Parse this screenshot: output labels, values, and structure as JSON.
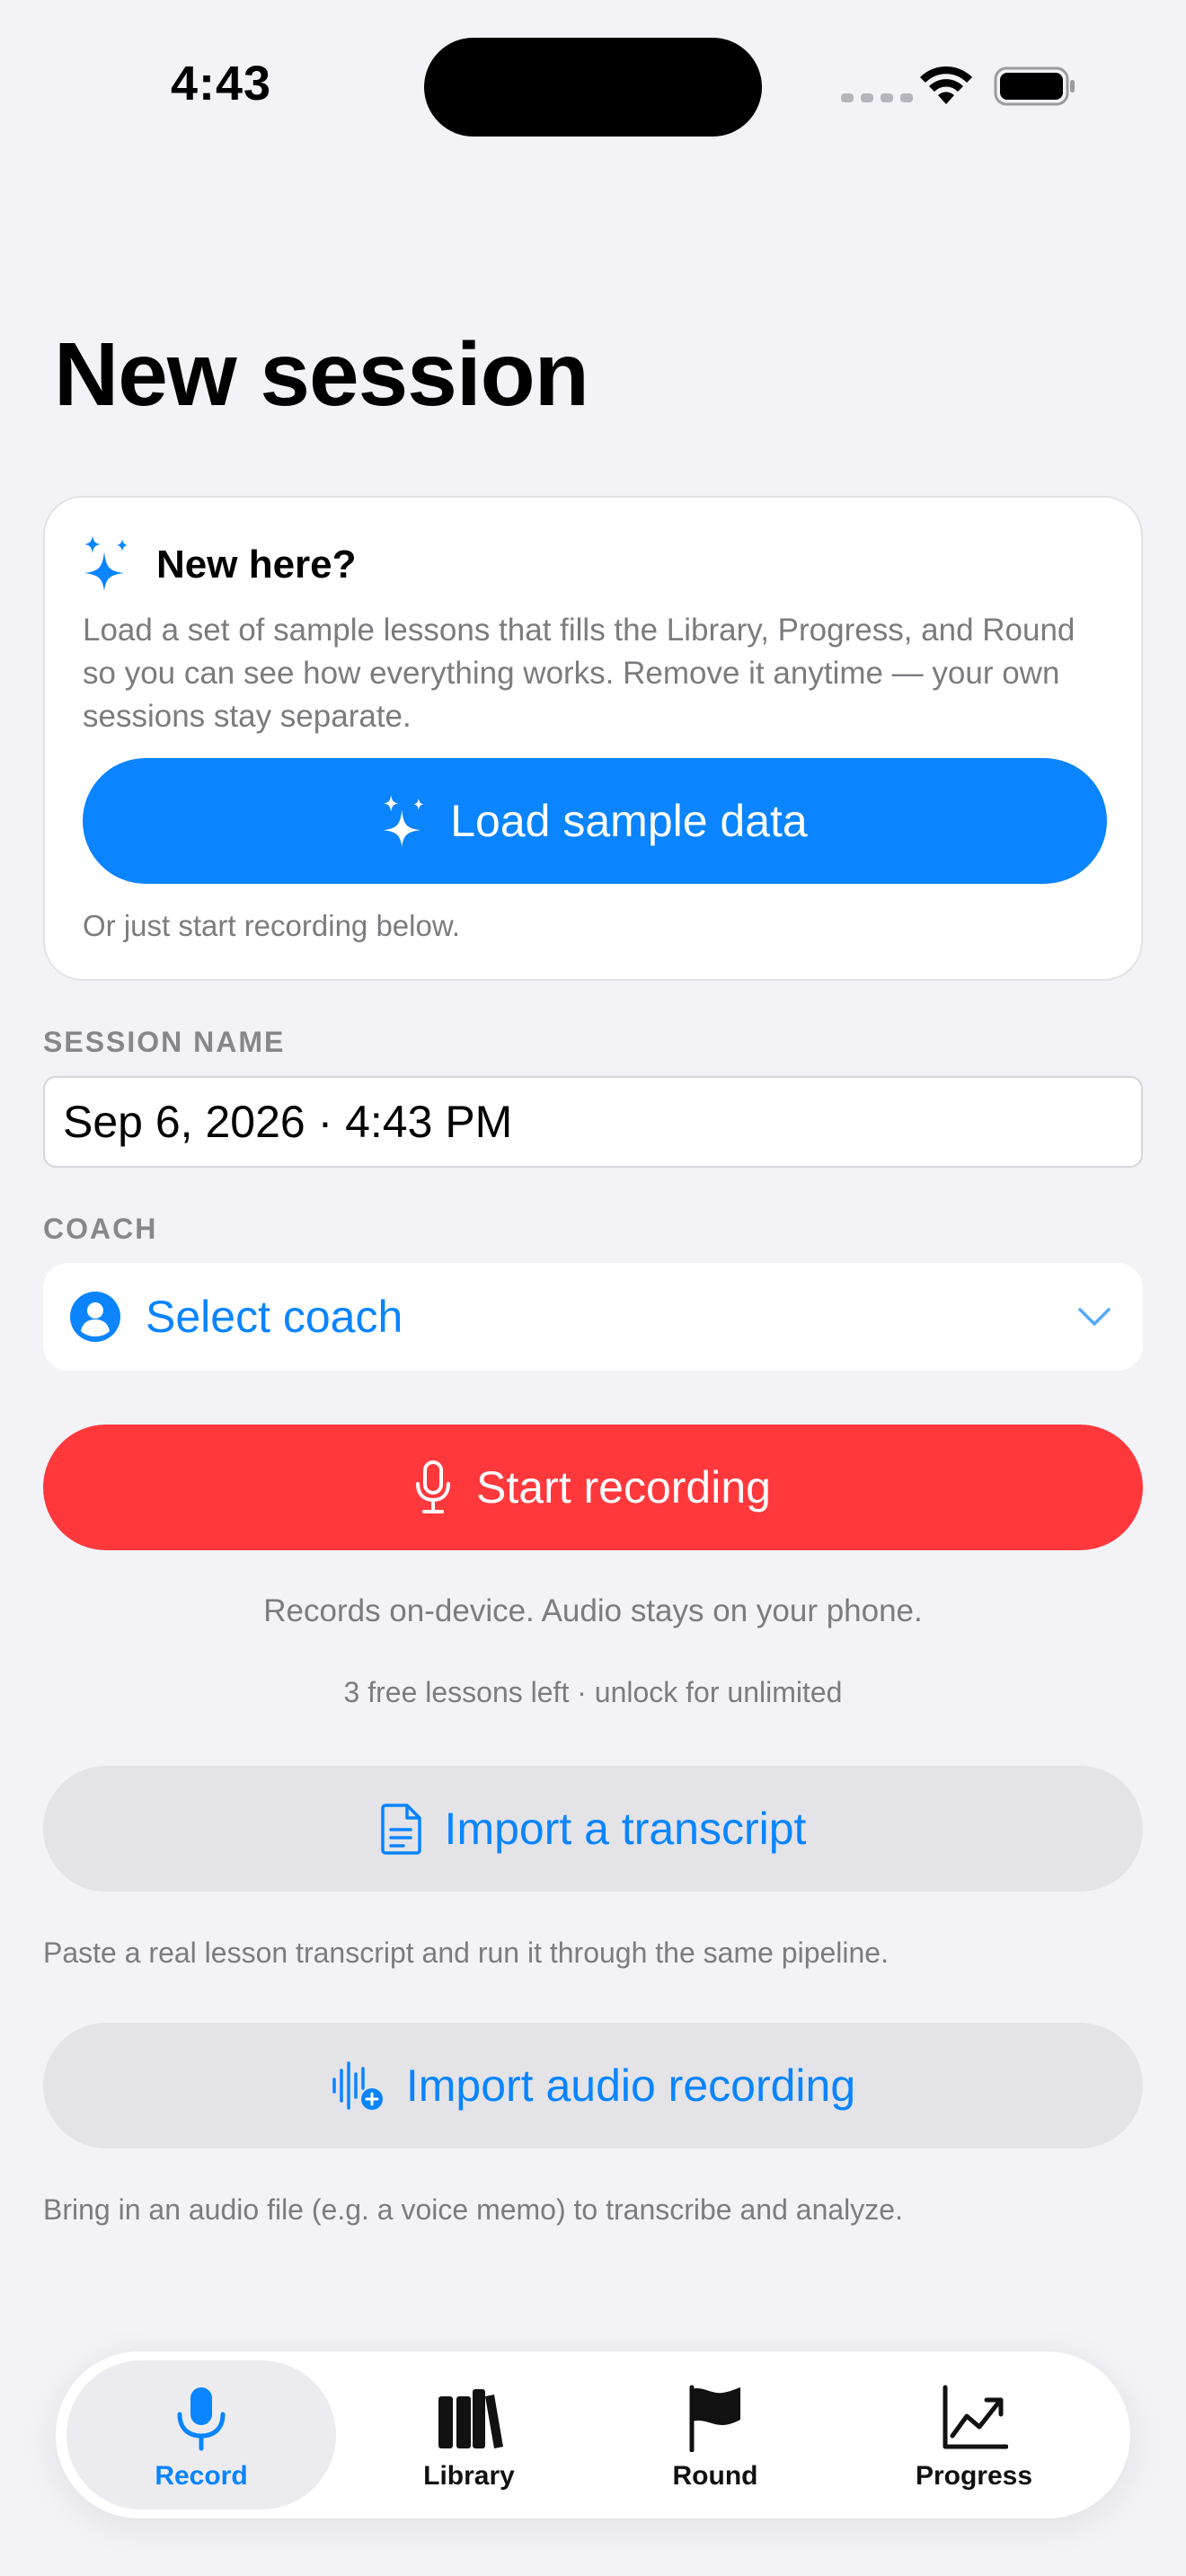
{
  "status": {
    "time": "4:43"
  },
  "page": {
    "title": "New session"
  },
  "welcome": {
    "title": "New here?",
    "text": "Load a set of sample lessons that fills the Library, Progress, and Round so you can see how everything works. Remove it anytime — your own sessions stay separate.",
    "button_label": "Load sample data",
    "footer": "Or just start recording below."
  },
  "session_name": {
    "label": "SESSION NAME",
    "value": "Sep 6, 2026 · 4:43 PM"
  },
  "coach": {
    "label": "COACH",
    "placeholder": "Select coach"
  },
  "record": {
    "button_label": "Start recording",
    "hint": "Records on-device. Audio stays on your phone.",
    "free_note": "3 free lessons left · unlock for unlimited"
  },
  "import_transcript": {
    "button_label": "Import a transcript",
    "description": "Paste a real lesson transcript and run it through the same pipeline."
  },
  "import_audio": {
    "button_label": "Import audio recording",
    "description": "Bring in an audio file (e.g. a voice memo) to transcribe and analyze."
  },
  "tabs": [
    {
      "label": "Record",
      "icon": "mic-icon",
      "active": true
    },
    {
      "label": "Library",
      "icon": "books-icon",
      "active": false
    },
    {
      "label": "Round",
      "icon": "flag-icon",
      "active": false
    },
    {
      "label": "Progress",
      "icon": "chart-icon",
      "active": false
    }
  ],
  "colors": {
    "accent": "#0a84ff",
    "record": "#ff383c",
    "background": "#f2f2f7"
  }
}
